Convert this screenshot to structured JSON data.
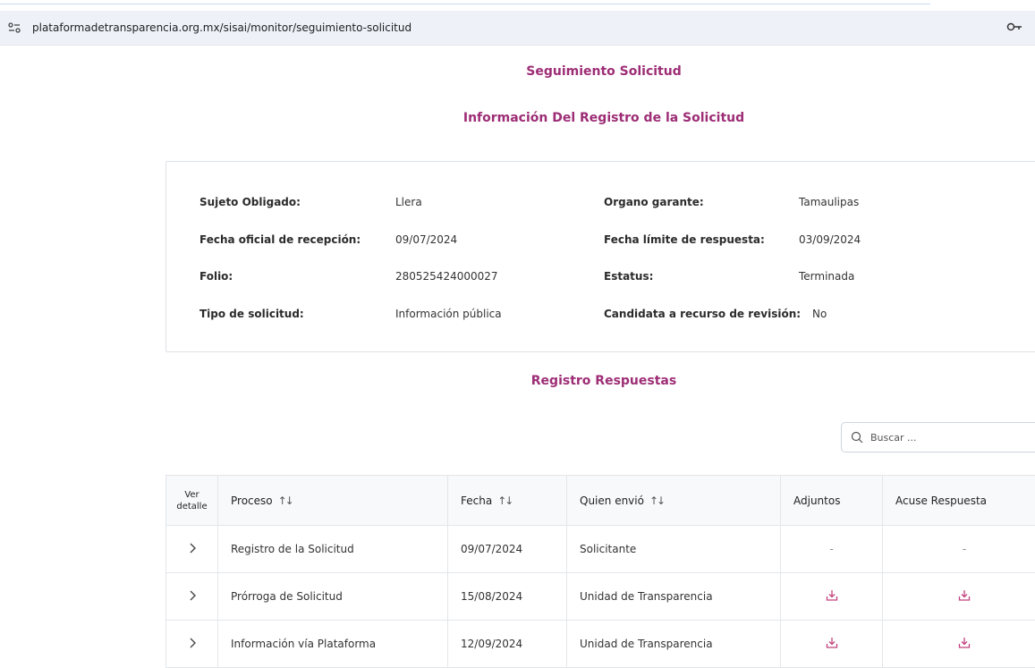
{
  "browser": {
    "url": "plataformadetransparencia.org.mx/sisai/monitor/seguimiento-solicitud"
  },
  "page": {
    "title": "Seguimiento Solicitud",
    "section_title": "Información Del Registro de la Solicitud",
    "respuestas_title": "Registro Respuestas"
  },
  "info": {
    "sujeto_label": "Sujeto Obligado:",
    "sujeto_value": "Llera",
    "fecha_rec_label": "Fecha oficial de recepción:",
    "fecha_rec_value": "09/07/2024",
    "folio_label": "Folio:",
    "folio_value": "280525424000027",
    "tipo_label": "Tipo de solicitud:",
    "tipo_value": "Información pública",
    "organo_label": "Organo garante:",
    "organo_value": "Tamaulipas",
    "fecha_lim_label": "Fecha límite de respuesta:",
    "fecha_lim_value": "03/09/2024",
    "estatus_label": "Estatus:",
    "estatus_value": "Terminada",
    "candidata_label": "Candidata a recurso de revisión:",
    "candidata_value": "No"
  },
  "search": {
    "placeholder": "Buscar ..."
  },
  "table": {
    "headers": {
      "ver_line1": "Ver",
      "ver_line2": "detalle",
      "proceso": "Proceso",
      "fecha": "Fecha",
      "quien": "Quien envió",
      "adjuntos": "Adjuntos",
      "acuse": "Acuse Respuesta"
    },
    "rows": [
      {
        "proceso": "Registro de la Solicitud",
        "fecha": "09/07/2024",
        "quien": "Solicitante",
        "adjuntos": "-",
        "acuse": "-"
      },
      {
        "proceso": "Prórroga de Solicitud",
        "fecha": "15/08/2024",
        "quien": "Unidad de Transparencia",
        "adjuntos": "download-icon",
        "acuse": "download-icon"
      },
      {
        "proceso": "Información vía Plataforma",
        "fecha": "12/09/2024",
        "quien": "Unidad de Transparencia",
        "adjuntos": "download-icon",
        "acuse": "download-icon"
      }
    ]
  },
  "colors": {
    "accent": "#9d2d75",
    "download": "#c2417d"
  }
}
